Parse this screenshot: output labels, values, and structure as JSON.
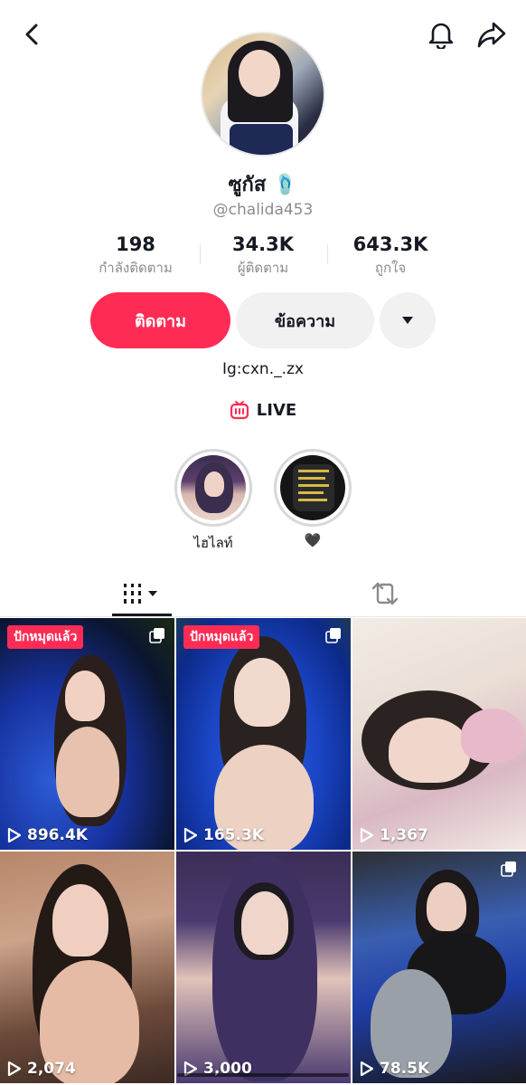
{
  "header": {
    "back_icon": "chevron-left-icon",
    "bell_icon": "bell-icon",
    "share_icon": "share-arrow-icon"
  },
  "profile": {
    "display_name": "ซูกัส",
    "display_name_emoji": "🩴",
    "handle": "@chalida453",
    "bio": "Ig:cxn._.zx"
  },
  "stats": [
    {
      "value": "198",
      "label": "กำลังติดตาม"
    },
    {
      "value": "34.3K",
      "label": "ผู้ติดตาม"
    },
    {
      "value": "643.3K",
      "label": "ถูกใจ"
    }
  ],
  "actions": {
    "follow_label": "ติดตาม",
    "message_label": "ข้อความ",
    "follow_color": "#fe2c55"
  },
  "live": {
    "label": "LIVE",
    "icon": "tv-live-icon",
    "color": "#fe2c55"
  },
  "highlights": [
    {
      "label": "ไฮไลท์"
    },
    {
      "label": "🖤"
    }
  ],
  "tabs": {
    "videos_icon": "grid-icon",
    "reposts_icon": "repost-icon"
  },
  "videos": [
    {
      "views": "896.4K",
      "pinned_label": "ปักหมุดแล้ว"
    },
    {
      "views": "165.3K",
      "pinned_label": "ปักหมุดแล้ว"
    },
    {
      "views": "1,367"
    },
    {
      "views": "2,074"
    },
    {
      "views": "3,000"
    },
    {
      "views": "78.5K"
    }
  ]
}
